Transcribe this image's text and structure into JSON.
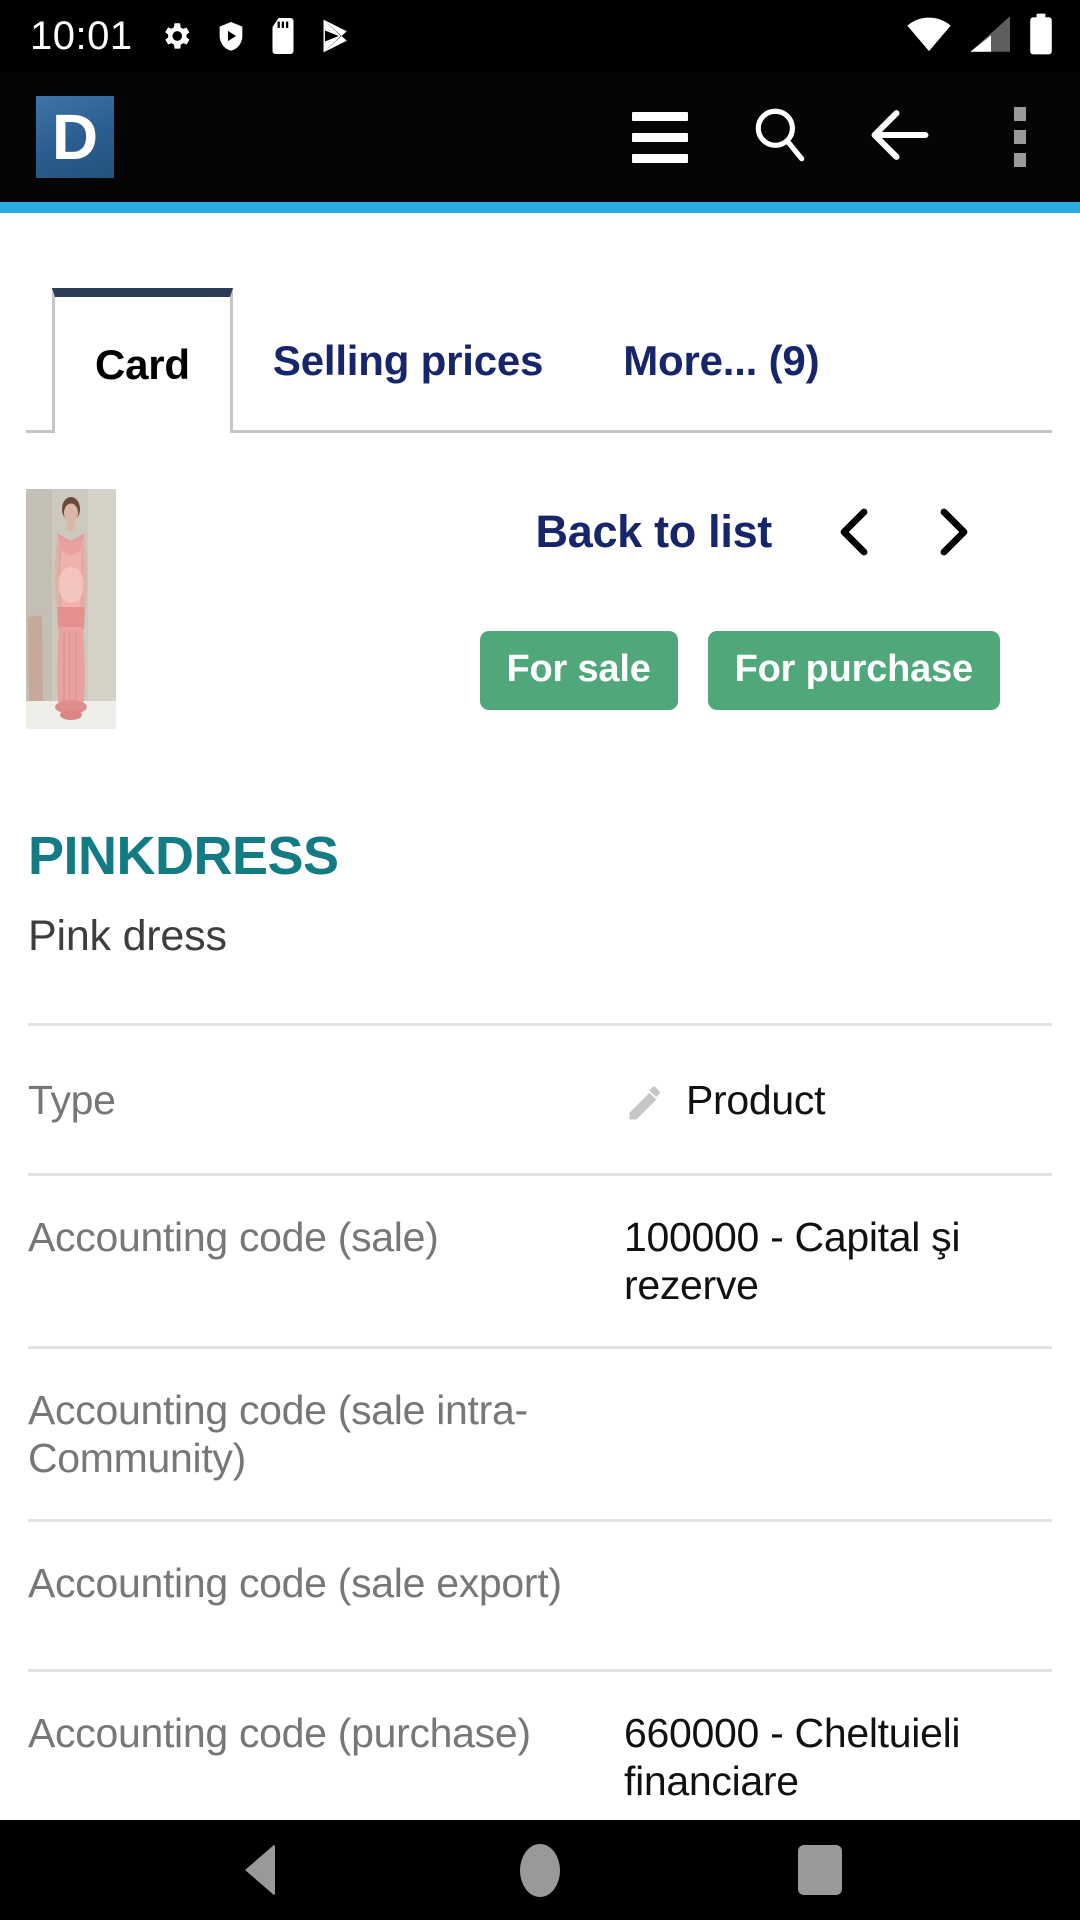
{
  "status_bar": {
    "clock": "10:01",
    "left_icons": [
      "settings-gear-icon",
      "play-protect-shield-icon",
      "sd-card-icon",
      "play-store-icon"
    ],
    "right_icons": [
      "wifi-icon",
      "cellular-signal-icon",
      "battery-icon"
    ]
  },
  "app_header": {
    "logo_letter": "D",
    "logo_color": "#2b5c8e",
    "accent_color": "#2cabe3",
    "actions": [
      "hamburger-menu-icon",
      "search-icon",
      "back-arrow-icon",
      "overflow-menu-icon"
    ]
  },
  "tabs": [
    {
      "label": "Card",
      "active": true
    },
    {
      "label": "Selling prices",
      "active": false
    },
    {
      "label": "More... (9)",
      "active": false
    }
  ],
  "navigation": {
    "back_to_list": "Back to list",
    "prev_icon": "chevron-left-icon",
    "next_icon": "chevron-right-icon"
  },
  "badges": [
    {
      "label": "For sale",
      "color": "#4fa77a"
    },
    {
      "label": "For purchase",
      "color": "#4fa77a"
    }
  ],
  "product": {
    "ref": "PINKDRESS",
    "ref_color": "#127b83",
    "label": "Pink dress",
    "thumbnail_alt": "pink dress on mannequin"
  },
  "details": [
    {
      "label": "Type",
      "value": "Product",
      "has_edit_icon": true
    },
    {
      "label": "Accounting code (sale)",
      "value": "100000 - Capital şi rezerve",
      "has_edit_icon": false
    },
    {
      "label": "Accounting code (sale intra-Community)",
      "value": "",
      "has_edit_icon": false
    },
    {
      "label": "Accounting code (sale export)",
      "value": "",
      "has_edit_icon": false
    },
    {
      "label": "Accounting code (purchase)",
      "value": "660000 - Cheltuieli financiare",
      "has_edit_icon": false
    }
  ],
  "android_nav": {
    "back": "back-triangle-icon",
    "home": "home-circle-icon",
    "recents": "recents-square-icon"
  }
}
